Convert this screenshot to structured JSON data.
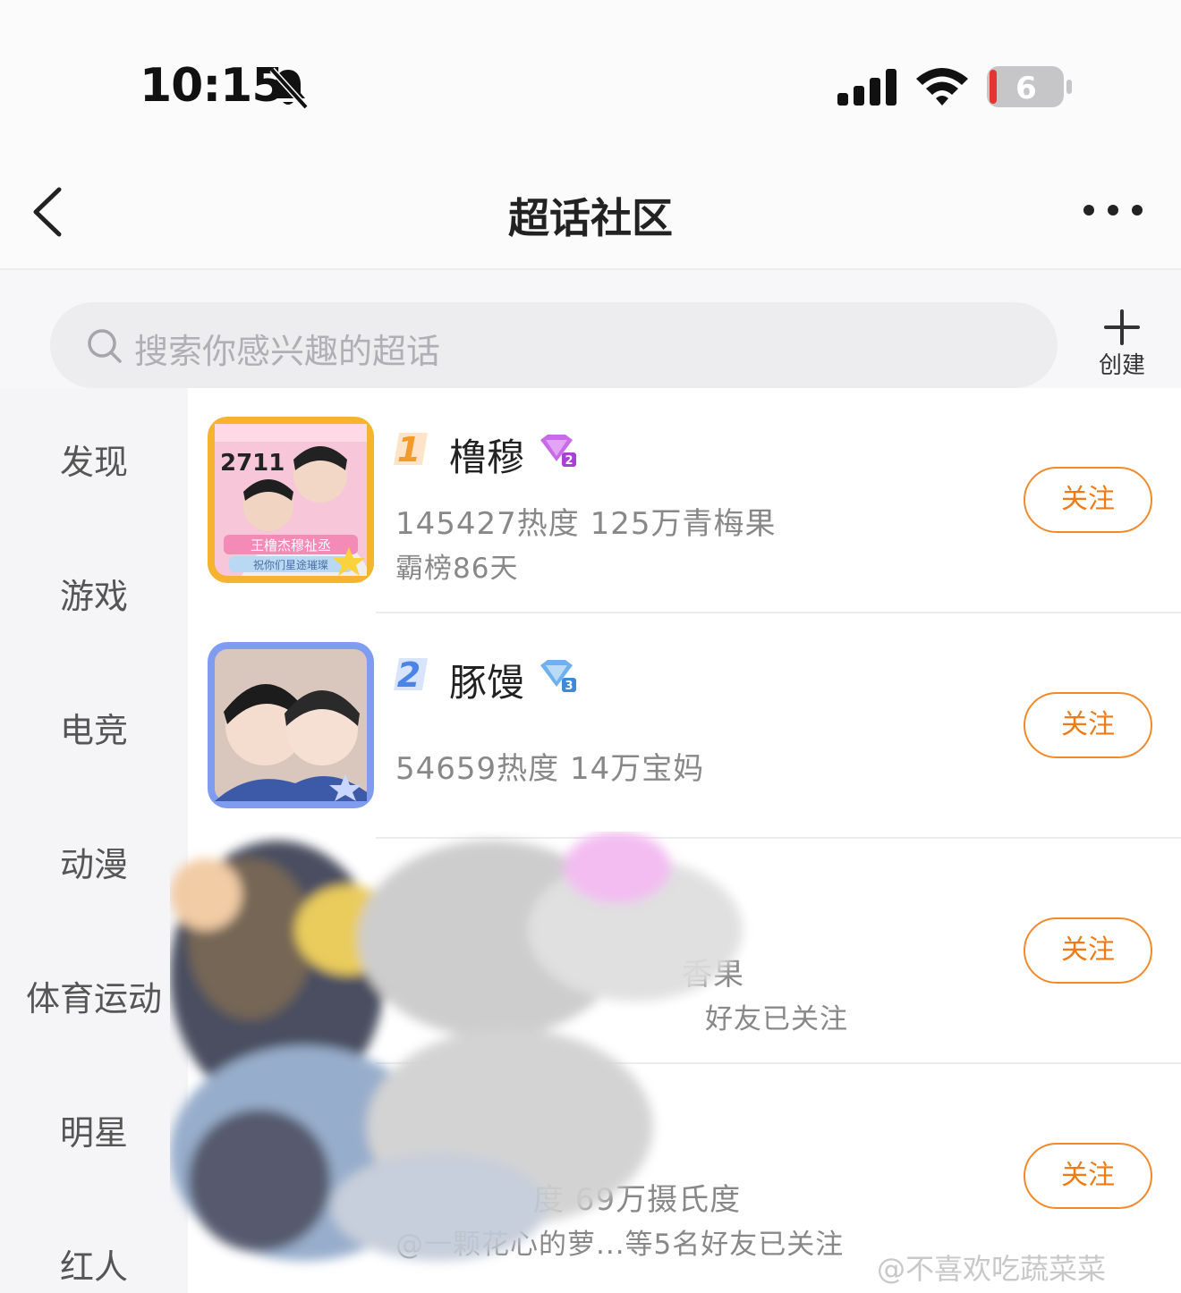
{
  "status_bar": {
    "time": "10:15",
    "battery_level": "6",
    "icons": [
      "bell-muted-icon",
      "cellular-signal-icon",
      "wifi-icon",
      "battery-icon"
    ]
  },
  "nav": {
    "title": "超话社区",
    "back_icon": "chevron-left-icon",
    "more_icon": "ellipsis-icon"
  },
  "search": {
    "placeholder": "搜索你感兴趣的超话",
    "create_label": "创建"
  },
  "sidebar": {
    "items": [
      {
        "label": "发现"
      },
      {
        "label": "游戏"
      },
      {
        "label": "电竞"
      },
      {
        "label": "动漫"
      },
      {
        "label": "体育运动"
      },
      {
        "label": "明星"
      },
      {
        "label": "红人"
      }
    ]
  },
  "list": {
    "items": [
      {
        "rank": "1",
        "name": "橹穆",
        "badge_level": "2",
        "stat_line1": "145427热度 125万青梅果",
        "stat_line2": "霸榜86天",
        "thumb_text_top": "2711",
        "thumb_text_banner": "王橹杰穆祉丞",
        "thumb_text_sub": "祝你们星途璀璨",
        "follow_label": "关注"
      },
      {
        "rank": "2",
        "name": "豚馒",
        "badge_level": "3",
        "stat_line1": "54659热度 14万宝妈",
        "follow_label": "关注"
      },
      {
        "stat_line1": "香果",
        "stat_line2": "好友已关注",
        "follow_label": "关注"
      },
      {
        "stat_line1": "度 69万摄氏度",
        "stat_line2": "@一颗花心的萝...等5名好友已关注",
        "follow_label": "关注"
      }
    ]
  },
  "watermark": "@不喜欢吃蔬菜菜",
  "colors": {
    "accent": "#f07a16",
    "rank1": "#f39a2b",
    "rank2": "#4a84e6",
    "badge1": "#b14fe0",
    "badge2": "#4a9be6"
  }
}
